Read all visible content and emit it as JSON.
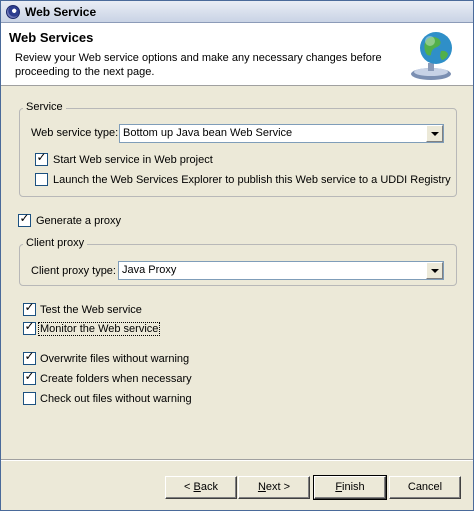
{
  "window": {
    "title": "Web Service"
  },
  "banner": {
    "title": "Web Services",
    "description": "Review your Web service options and make any necessary changes before proceeding to the next page."
  },
  "service_group": {
    "legend": "Service",
    "type_label": "Web service type:",
    "type_value": "Bottom up Java bean Web Service",
    "start_label": "Start Web service in Web project",
    "start_checked": true,
    "launch_label": "Launch the Web Services Explorer to publish this Web service to a UDDI Registry",
    "launch_checked": false
  },
  "generate_proxy": {
    "label": "Generate a proxy",
    "checked": true
  },
  "client_proxy_group": {
    "legend": "Client proxy",
    "type_label": "Client proxy type:",
    "type_value": "Java Proxy"
  },
  "options": {
    "test": {
      "label": "Test the Web service",
      "checked": true
    },
    "monitor": {
      "label": "Monitor the Web service",
      "checked": true
    },
    "overwrite": {
      "label": "Overwrite files without warning",
      "checked": true
    },
    "create_folders": {
      "label": "Create folders when necessary",
      "checked": true
    },
    "checkout": {
      "label": "Check out files without warning",
      "checked": false
    }
  },
  "buttons": {
    "back": {
      "pre": "< ",
      "mnemonic": "B",
      "post": "ack"
    },
    "next": {
      "mnemonic": "N",
      "post": "ext >"
    },
    "finish": {
      "mnemonic": "F",
      "post": "inish"
    },
    "cancel": "Cancel"
  },
  "icons": {
    "app": "eclipse-icon",
    "banner": "web-service-globe-icon"
  }
}
